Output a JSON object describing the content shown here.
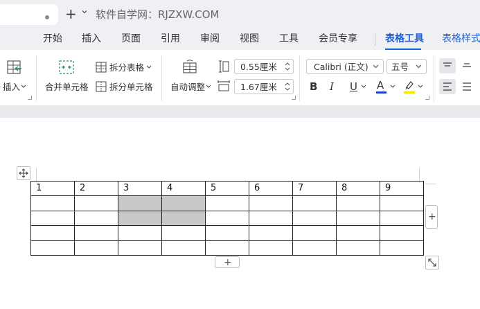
{
  "titlebar": {
    "title": "软件自学网：RJZXW.COM"
  },
  "menu": {
    "items": [
      "开始",
      "插入",
      "页面",
      "引用",
      "审阅",
      "视图",
      "工具",
      "会员专享",
      "表格工具",
      "表格样式"
    ],
    "active_index": 8
  },
  "ribbon": {
    "insert_label": "插入",
    "merge_label": "合并单元格",
    "split_table_label": "拆分表格",
    "split_cells_label": "拆分单元格",
    "auto_adjust_label": "自动调整",
    "row_height_value": "0.55厘米",
    "col_width_value": "1.67厘米",
    "font_name": "Calibri (正文)",
    "font_size": "五号",
    "bold_label": "B",
    "italic_label": "I",
    "underline_label": "U",
    "font_color_label": "A",
    "font_color": "#1f3fd6",
    "highlight_color": "#f2e600"
  },
  "table": {
    "rows": [
      [
        "1",
        "2",
        "3",
        "4",
        "5",
        "6",
        "7",
        "8",
        "9"
      ],
      [
        "",
        "",
        "",
        "",
        "",
        "",
        "",
        "",
        ""
      ],
      [
        "",
        "",
        "",
        "",
        "",
        "",
        "",
        "",
        ""
      ],
      [
        "",
        "",
        "",
        "",
        "",
        "",
        "",
        "",
        ""
      ],
      [
        "",
        "",
        "",
        "",
        "",
        "",
        "",
        "",
        ""
      ]
    ],
    "selected_cells": [
      [
        1,
        2
      ],
      [
        1,
        3
      ],
      [
        2,
        2
      ],
      [
        2,
        3
      ]
    ]
  },
  "controls": {
    "add_column_label": "+",
    "add_row_label": "+"
  },
  "colors": {
    "accent": "#1b5fd9",
    "selection": "#c8c8c8"
  },
  "icons": [
    "move-table-icon",
    "resize-table-icon",
    "insert-icon",
    "merge-cells-icon",
    "split-table-icon",
    "split-cells-icon",
    "auto-adjust-icon",
    "row-height-icon",
    "col-width-icon",
    "align-top-icon",
    "align-center-icon",
    "align-left-icon",
    "align-justify-icon"
  ]
}
